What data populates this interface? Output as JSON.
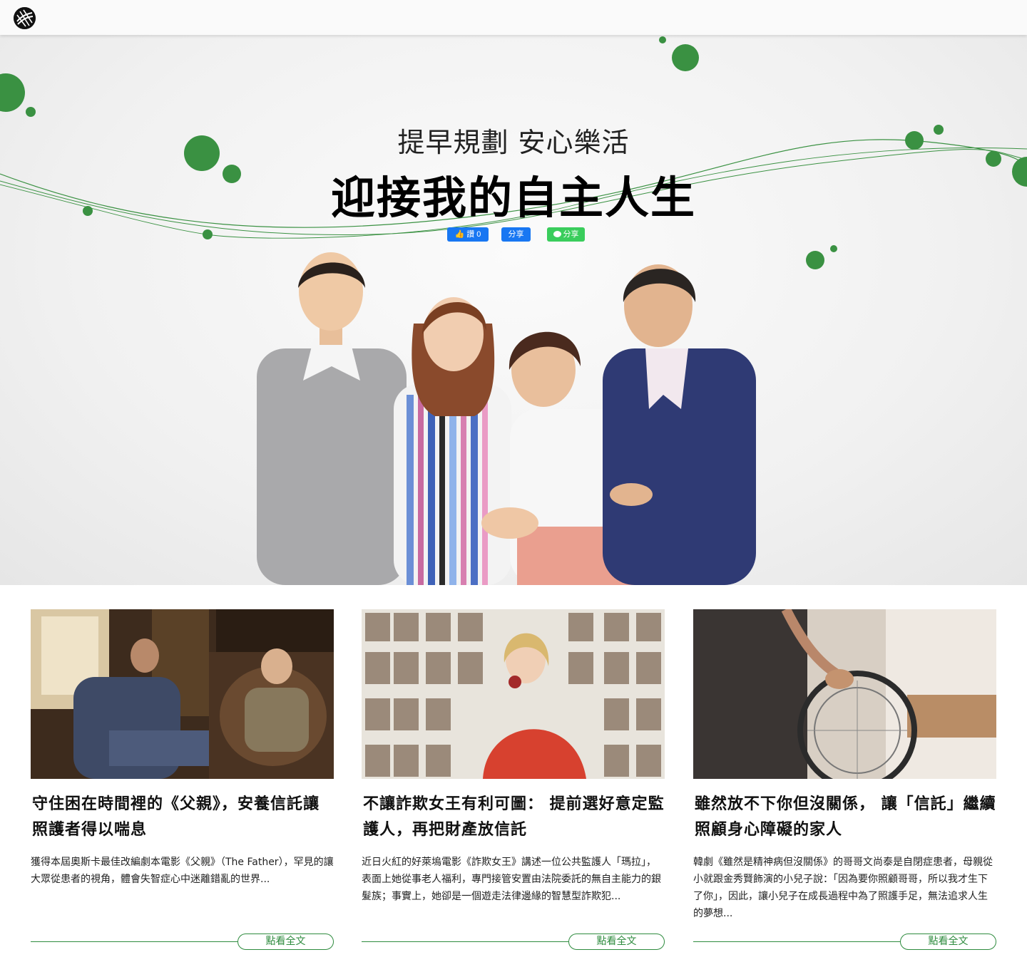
{
  "header": {
    "logo_icon": "globe-logo-icon"
  },
  "hero": {
    "subtitle": "提早規劃 安心樂活",
    "title": "迎接我的自主人生",
    "share": {
      "fb_like_label": "讚 0",
      "fb_share_label": "分享",
      "line_share_label": "分享"
    },
    "accent_color": "#3a9142"
  },
  "articles": [
    {
      "title": "守住困在時間裡的《父親》，安養信託讓照護者得以喘息",
      "excerpt": "獲得本屆奧斯卡最佳改編劇本電影《父親》（The Father），罕見的讓大眾從患者的視角，體會失智症心中迷離錯亂的世界...",
      "read_more": "點看全文"
    },
    {
      "title": "不讓詐欺女王有利可圖： 提前選好意定監護人，再把財產放信託",
      "excerpt": "近日火紅的好萊塢電影《詐欺女王》講述一位公共監護人「瑪拉」，表面上她從事老人福利，專門接管安置由法院委託的無自主能力的銀髮族；事實上，她卻是一個遊走法律邊緣的智慧型詐欺犯...",
      "read_more": "點看全文"
    },
    {
      "title": "雖然放不下你但沒關係， 讓「信託」繼續照顧身心障礙的家人",
      "excerpt": "韓劇《雖然是精神病但沒關係》的哥哥文尚泰是自閉症患者，母親從小就跟金秀賢飾演的小兒子說：「因為要你照顧哥哥，所以我才生下了你」，因此，讓小兒子在成長過程中為了照護手足，無法追求人生的夢想...",
      "read_more": "點看全文"
    }
  ]
}
